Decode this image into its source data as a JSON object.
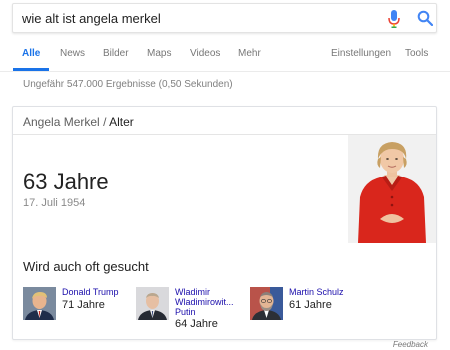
{
  "search": {
    "query": "wie alt ist angela merkel",
    "mic_icon": "mic-icon",
    "search_icon": "search-icon",
    "mic_colors": [
      "#4285f4",
      "#ea4335",
      "#fbbc05",
      "#34a853"
    ],
    "search_icon_color": "#4285f4"
  },
  "tabs": {
    "all": "Alle",
    "news": "News",
    "images": "Bilder",
    "maps": "Maps",
    "videos": "Videos",
    "more": "Mehr",
    "settings": "Einstellungen",
    "tools": "Tools",
    "active_color": "#1a73e8"
  },
  "result_stats": "Ungefähr 547.000 Ergebnisse (0,50 Sekunden)",
  "answer_card": {
    "breadcrumb_entity": "Angela Merkel",
    "breadcrumb_separator": "/",
    "breadcrumb_attribute": "Alter",
    "value": "63 Jahre",
    "date": "17. Juli 1954",
    "related_heading": "Wird auch oft gesucht",
    "related": [
      {
        "name_line1": "Donald Trump",
        "name_line2": "",
        "name_line3": "",
        "age": "71 Jahre"
      },
      {
        "name_line1": "Wladimir",
        "name_line2": "Wladimirowit...",
        "name_line3": "Putin",
        "age": "64 Jahre"
      },
      {
        "name_line1": "Martin Schulz",
        "name_line2": "",
        "name_line3": "",
        "age": "61 Jahre"
      }
    ],
    "link_color": "#1a0dab"
  },
  "feedback": "Feedback"
}
